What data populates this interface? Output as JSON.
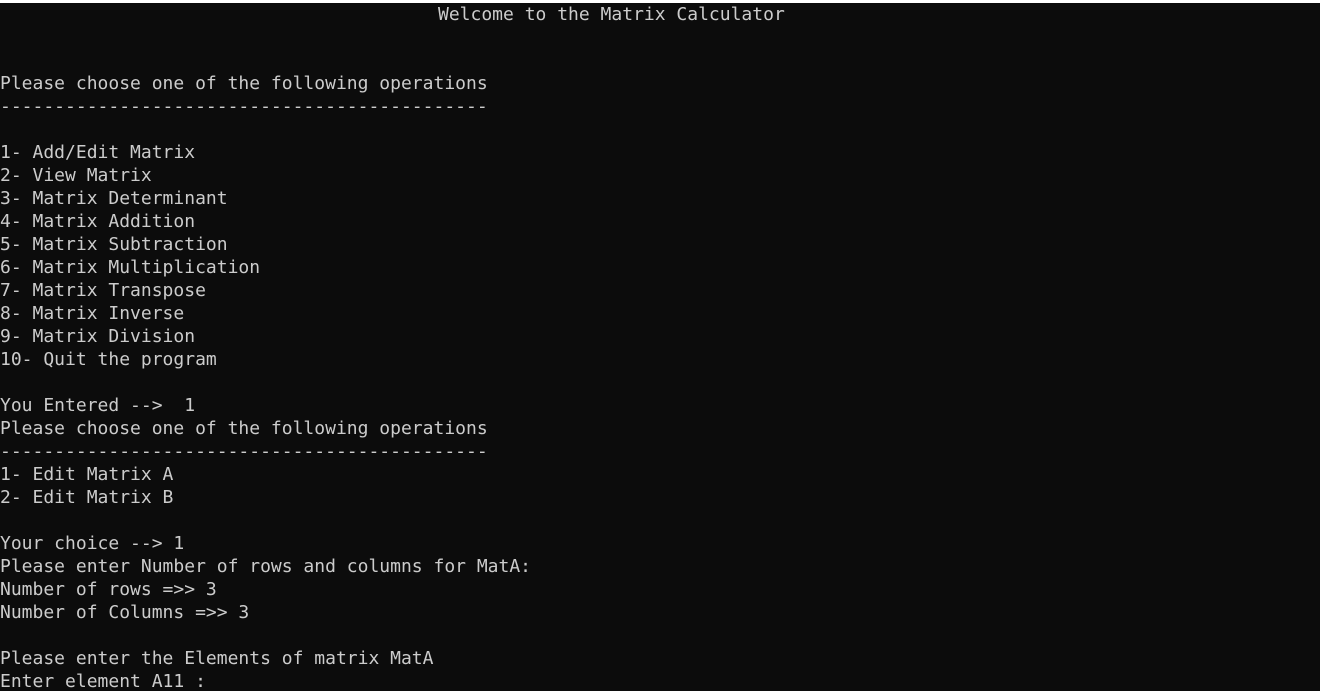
{
  "title": "Welcome to the Matrix Calculator",
  "main_menu": {
    "prompt": "Please choose one of the following operations",
    "separator": "---------------------------------------------",
    "options": [
      "1- Add/Edit Matrix",
      "2- View Matrix",
      "3- Matrix Determinant",
      "4- Matrix Addition",
      "5- Matrix Subtraction",
      "6- Matrix Multiplication",
      "7- Matrix Transpose",
      "8- Matrix Inverse",
      "9- Matrix Division",
      "10- Quit the program"
    ],
    "entered": "You Entered -->  1"
  },
  "sub_menu": {
    "prompt": "Please choose one of the following operations",
    "separator": "---------------------------------------------",
    "options": [
      "1- Edit Matrix A",
      "2- Edit Matrix B"
    ],
    "choice": "Your choice --> 1"
  },
  "matrix_input": {
    "size_prompt": "Please enter Number of rows and columns for MatA:",
    "rows": "Number of rows =>> 3",
    "columns": "Number of Columns =>> 3",
    "elements_prompt": "Please enter the Elements of matrix MatA",
    "element_prompt": "Enter element A11 : "
  }
}
